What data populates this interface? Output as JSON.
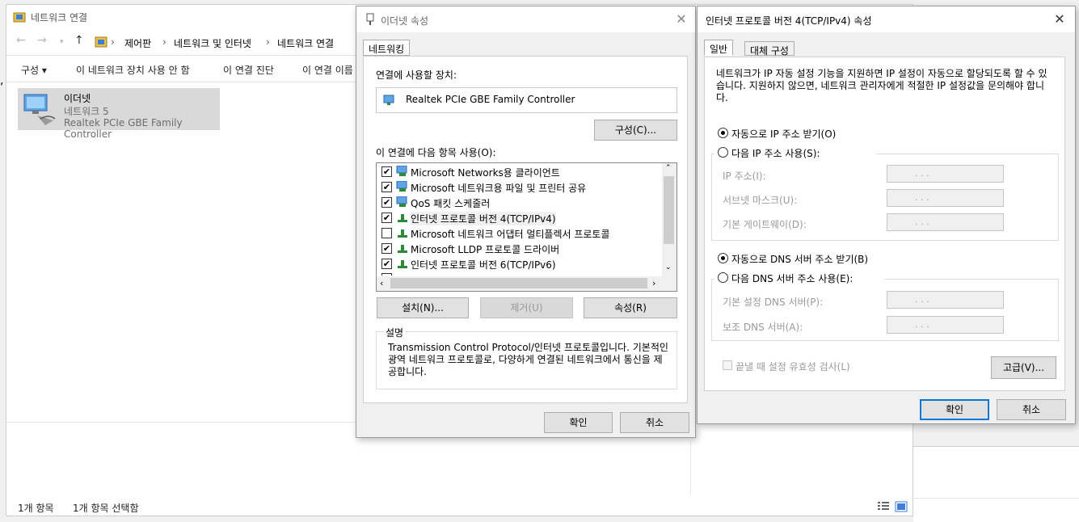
{
  "explorer": {
    "title": "네트워크 연결",
    "breadcrumb": [
      "제어판",
      "네트워크 및 인터넷",
      "네트워크 연결"
    ],
    "toolbar": [
      "구성 ▾",
      "이 네트워크 장치 사용 안 함",
      "이 연결 진단",
      "이 연결 이름"
    ],
    "item": {
      "name": "이더넷",
      "network": "네트워크 5",
      "adapter": "Realtek PCIe GBE Family Controller"
    },
    "status": {
      "count": "1개 항목",
      "selected": "1개 항목 선택함"
    }
  },
  "props": {
    "title": "이더넷 속성",
    "tab": "네트워킹",
    "connect_using_label": "연결에 사용할 장치:",
    "adapter": "Realtek PCIe GBE Family Controller",
    "configure_btn": "구성(C)...",
    "items_label": "이 연결에 다음 항목 사용(O):",
    "items": [
      {
        "label": "Microsoft Networks용 클라이언트",
        "checked": true
      },
      {
        "label": "Microsoft 네트워크용 파일 및 프린터 공유",
        "checked": true
      },
      {
        "label": "QoS 패킷 스케줄러",
        "checked": true
      },
      {
        "label": "인터넷 프로토콜 버전 4(TCP/IPv4)",
        "checked": true
      },
      {
        "label": "Microsoft 네트워크 어댑터 멀티플렉서 프로토콜",
        "checked": false
      },
      {
        "label": "Microsoft LLDP 프로토콜 드라이버",
        "checked": true
      },
      {
        "label": "인터넷 프로토콜 버전 6(TCP/IPv6)",
        "checked": true
      }
    ],
    "install_btn": "설치(N)...",
    "remove_btn": "제거(U)",
    "properties_btn": "속성(R)",
    "desc_label": "설명",
    "description": "Transmission Control Protocol/인터넷 프로토콜입니다. 기본적인 광역 네트워크 프로토콜로, 다양하게 연결된 네트워크에서 통신을 제공합니다.",
    "ok": "확인",
    "cancel": "취소"
  },
  "ipv4": {
    "title": "인터넷 프로토콜 버전 4(TCP/IPv4) 속성",
    "tabs": [
      "일반",
      "대체 구성"
    ],
    "intro": "네트워크가 IP 자동 설정 기능을 지원하면 IP 설정이 자동으로 할당되도록 할 수 있습니다. 지원하지 않으면, 네트워크 관리자에게 적절한 IP 설정값을 문의해야 합니다.",
    "auto_ip": "자동으로 IP 주소 받기(O)",
    "manual_ip": "다음 IP 주소 사용(S):",
    "ip_label": "IP 주소(I):",
    "mask_label": "서브넷 마스크(U):",
    "gateway_label": "기본 게이트웨이(D):",
    "auto_dns": "자동으로 DNS 서버 주소 받기(B)",
    "manual_dns": "다음 DNS 서버 주소 사용(E):",
    "pref_dns": "기본 설정 DNS 서버(P):",
    "alt_dns": "보조 DNS 서버(A):",
    "validate": "끝낼 때 설정 유효성 검사(L)",
    "advanced_btn": "고급(V)...",
    "ok": "확인",
    "cancel": "취소",
    "ip_placeholder": ".     .     ."
  }
}
